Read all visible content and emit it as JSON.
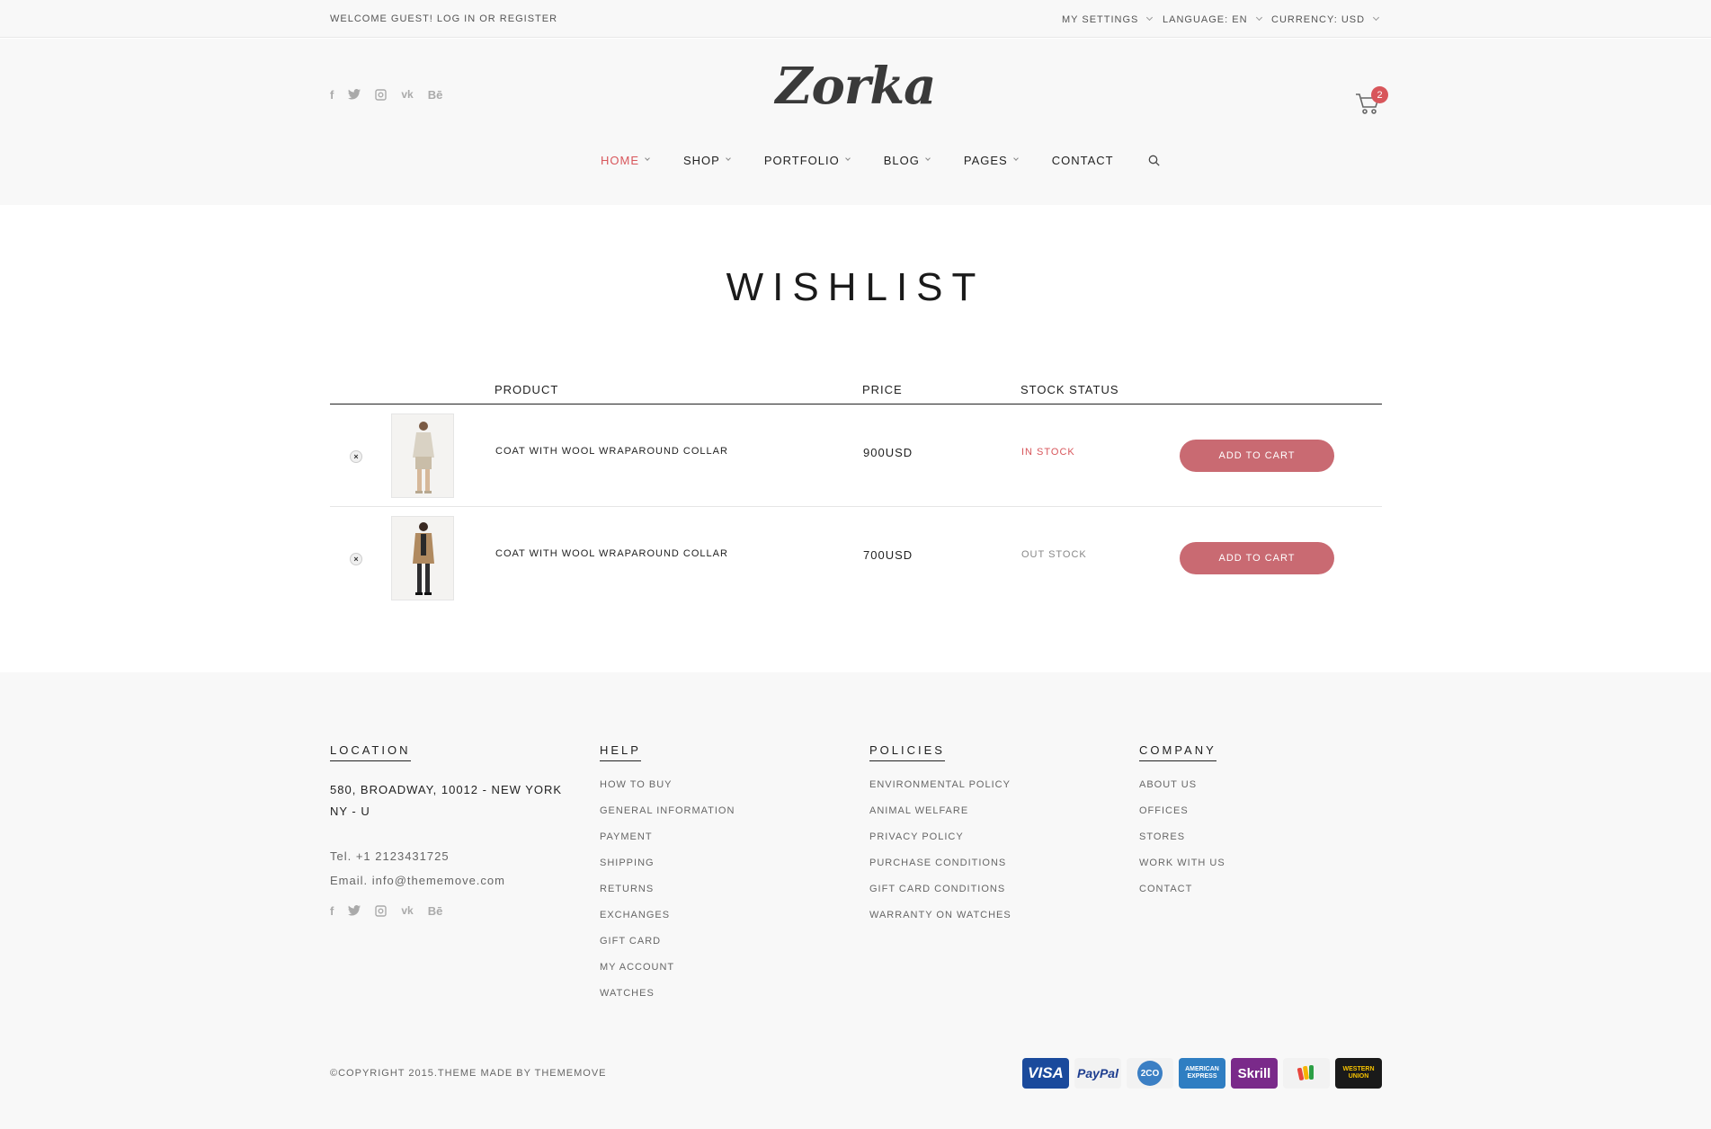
{
  "topbar": {
    "welcome": "WELCOME GUEST! LOG IN OR REGISTER",
    "settings": "MY SETTINGS",
    "language": "LANGUAGE: EN",
    "currency": "CURRENCY: USD"
  },
  "header": {
    "logo": "Zorka",
    "cart_count": "2",
    "social": [
      "f",
      "t",
      "ig",
      "vk",
      "Bē"
    ]
  },
  "nav": {
    "items": [
      {
        "label": "HOME"
      },
      {
        "label": "SHOP"
      },
      {
        "label": "PORTFOLIO"
      },
      {
        "label": "BLOG"
      },
      {
        "label": "PAGES"
      },
      {
        "label": "CONTACT"
      }
    ]
  },
  "page": {
    "title": "WISHLIST"
  },
  "table": {
    "headers": {
      "product": "PRODUCT",
      "price": "PRICE",
      "stock": "STOCK STATUS"
    },
    "rows": [
      {
        "remove": "×",
        "name": "COAT WITH WOOL WRAPAROUND COLLAR",
        "price": "900USD",
        "stock": "IN STOCK",
        "button": "ADD TO CART"
      },
      {
        "remove": "×",
        "name": "COAT WITH WOOL WRAPAROUND COLLAR",
        "price": "700USD",
        "stock": "OUT STOCK",
        "button": "ADD TO CART"
      }
    ]
  },
  "colors": {
    "accent": "#d8565b",
    "button": "#c96a72"
  },
  "footer": {
    "location": {
      "heading": "LOCATION",
      "address_line1": "580, BROADWAY, 10012 - NEW YORK",
      "address_line2": "NY - U",
      "tel": "Tel. +1 2123431725",
      "email": "Email. info@thememove.com"
    },
    "help": {
      "heading": "HELP",
      "links": [
        "HOW TO BUY",
        "GENERAL INFORMATION",
        "PAYMENT",
        "SHIPPING",
        "RETURNS",
        "EXCHANGES",
        "GIFT CARD",
        "MY ACCOUNT",
        "WATCHES"
      ]
    },
    "policies": {
      "heading": "POLICIES",
      "links": [
        "ENVIRONMENTAL POLICY",
        "ANIMAL WELFARE",
        "PRIVACY POLICY",
        "PURCHASE CONDITIONS",
        "GIFT CARD CONDITIONS",
        "WARRANTY ON WATCHES"
      ]
    },
    "company": {
      "heading": "COMPANY",
      "links": [
        "ABOUT US",
        "OFFICES",
        "STORES",
        "WORK WITH US",
        "CONTACT"
      ]
    },
    "copyright": "©COPYRIGHT 2015.THEME MADE BY THEMEMOVE",
    "payments": [
      {
        "label": "VISA",
        "color": "#1a4a9c"
      },
      {
        "label": "PayPal",
        "color": "#f2f2f2"
      },
      {
        "label": "2CO",
        "color": "#f2f2f2"
      },
      {
        "label": "AMERICAN EXPRESS",
        "color": "#2f7ec2"
      },
      {
        "label": "Skrill",
        "color": "#7a2a8a"
      },
      {
        "label": "Google Wallet",
        "color": "#f2f2f2"
      },
      {
        "label": "WESTERN UNION",
        "color": "#1a1a1a"
      }
    ]
  }
}
